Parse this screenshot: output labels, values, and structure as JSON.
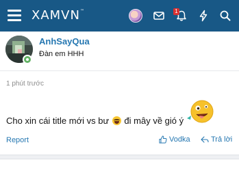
{
  "header": {
    "logo_text": "XAMVN",
    "logo_mark": "™",
    "notification_count": "1",
    "brand_color": "#185886",
    "icons": [
      "menu-icon",
      "user-avatar",
      "envelope-icon",
      "bell-icon",
      "bolt-icon",
      "search-icon"
    ]
  },
  "post": {
    "author": "AnhSayQua",
    "author_title": "Đàn em HHH",
    "online": true,
    "time": "1 phút trước",
    "message_before": "Cho xin cái title mới vs bư",
    "message_after": "đi mây về gió ý",
    "inline_smilie": "laughing-smilie",
    "large_emoji": "wacky-emoji",
    "actions": {
      "report": "Report",
      "like": "Vodka",
      "reply": "Trả lời"
    },
    "link_color": "#2577b1"
  }
}
